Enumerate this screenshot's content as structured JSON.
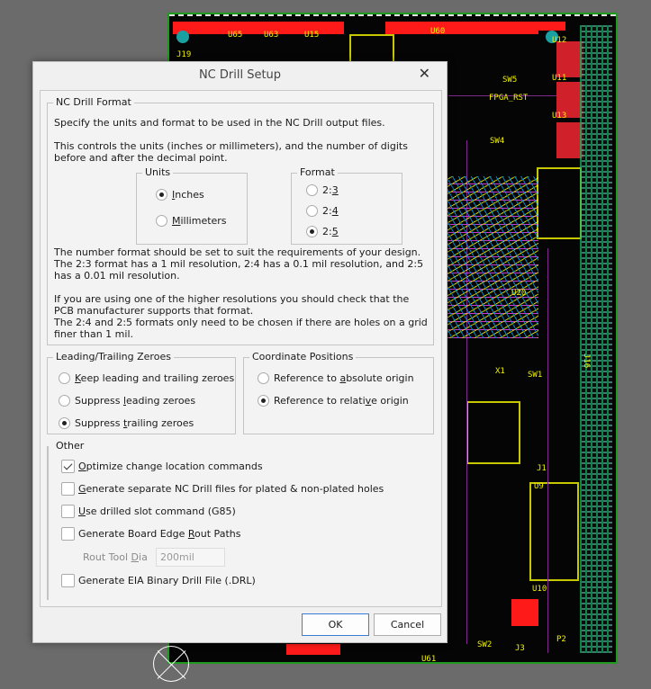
{
  "pcb": {
    "labels": [
      "U65",
      "U63",
      "U15",
      "U60",
      "J19",
      "SW5",
      "FPGA_RST",
      "U12",
      "U11",
      "U13",
      "SW4",
      "U20",
      "X1",
      "SW1",
      "J1",
      "U9",
      "U10",
      "SW2",
      "J3",
      "P2",
      "U61",
      "J16"
    ]
  },
  "dialog": {
    "title": "NC Drill Setup",
    "close": "✕",
    "format_group": {
      "title": "NC Drill Format",
      "intro": "Specify the units and format to be used in the NC Drill output files.",
      "intro2": "This controls the units (inches or millimeters), and the number of digits before and after the decimal point.",
      "units": {
        "title": "Units",
        "options": [
          "Inches",
          "Millimeters"
        ],
        "selected": "Inches"
      },
      "format": {
        "title": "Format",
        "options": [
          "2:3",
          "2:4",
          "2:5"
        ],
        "selected": "2:5"
      },
      "note1": "The number format should be set to suit the requirements of your design.",
      "note2": "The 2:3 format has a 1 mil resolution, 2:4 has a 0.1 mil resolution, and 2:5 has a 0.01 mil resolution.",
      "note3": "If you are using one of the higher resolutions you should check that the PCB manufacturer supports that format.",
      "note4": "The 2:4 and 2:5 formats only need to be chosen if there are holes on a grid finer than 1 mil."
    },
    "zeroes": {
      "title": "Leading/Trailing Zeroes",
      "options": [
        "Keep leading and trailing zeroes",
        "Suppress leading zeroes",
        "Suppress trailing zeroes"
      ],
      "selected": "Suppress trailing zeroes"
    },
    "coords": {
      "title": "Coordinate Positions",
      "options": [
        "Reference to absolute origin",
        "Reference to relative origin"
      ],
      "selected": "Reference to relative origin"
    },
    "other": {
      "title": "Other",
      "optimize": {
        "label": "Optimize change location commands",
        "checked": true
      },
      "separate": {
        "label": "Generate separate NC Drill files for plated & non-plated holes",
        "checked": false
      },
      "slot": {
        "label": "Use drilled slot command (G85)",
        "checked": false
      },
      "rout": {
        "label": "Generate Board Edge Rout Paths",
        "checked": false
      },
      "rout_dia_label": "Rout Tool Dia",
      "rout_dia_value": "200mil",
      "eia": {
        "label": "Generate EIA Binary Drill File (.DRL)",
        "checked": false
      }
    },
    "ok": "OK",
    "cancel": "Cancel"
  }
}
